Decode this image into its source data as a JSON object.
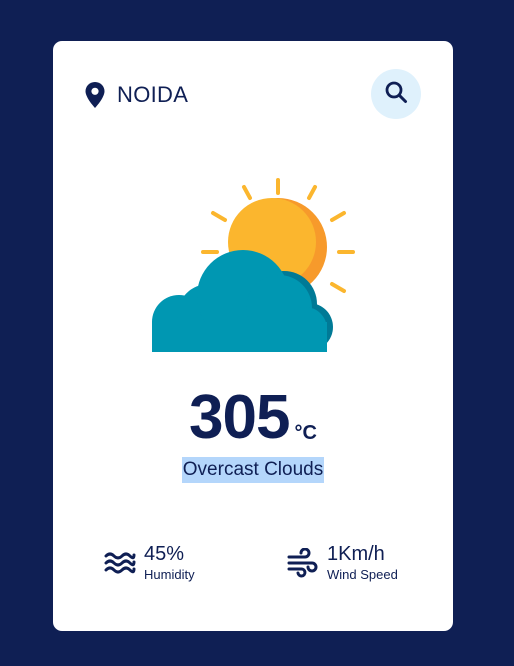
{
  "location": {
    "city": "NOIDA",
    "icon": "map-pin-icon"
  },
  "search": {
    "icon": "search-icon"
  },
  "weather": {
    "icon": "sun-behind-cloud-icon",
    "temperature": "305",
    "unit": "°C",
    "condition": "Overcast Clouds"
  },
  "stats": {
    "humidity": {
      "icon": "waves-icon",
      "value": "45%",
      "label": "Humidity"
    },
    "wind": {
      "icon": "wind-icon",
      "value": "1Km/h",
      "label": "Wind Speed"
    }
  },
  "colors": {
    "background": "#0f1f54",
    "card": "#ffffff",
    "text": "#0f1f54",
    "search_button_bg": "#dff1fc",
    "sun": "#fbb62e",
    "sun_shadow": "#f79a2b",
    "cloud": "#0097b2",
    "cloud_shadow": "#007a96",
    "selection_highlight": "#b4d6fb"
  }
}
